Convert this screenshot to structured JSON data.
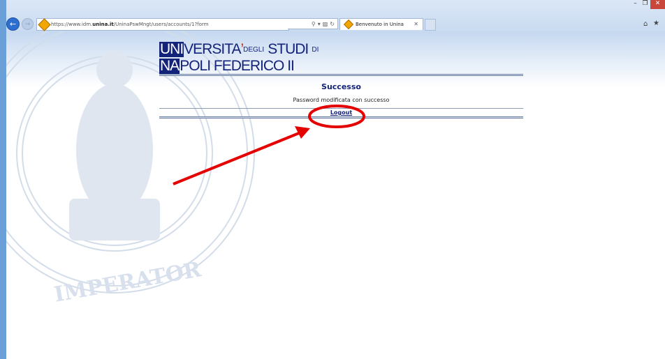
{
  "browser": {
    "url_prefix": "https://www.idm.",
    "url_domain": "unina.it",
    "url_path": "/UninaPswMngt/users/accounts/1?form",
    "tab_title": "Benvenuto in Unina",
    "back_icon": "back-arrow-icon",
    "forward_icon": "forward-arrow-icon"
  },
  "logo": {
    "uni": "UNI",
    "versita": "VERSITA",
    "apostrophe": "’",
    "degli": "DEGLI",
    "studi": "STUDI",
    "di": "DI",
    "na": "NA",
    "poli": "POLI FEDERICO II"
  },
  "content": {
    "title": "Successo",
    "message": "Password modificata con successo",
    "logout_label": "Logout"
  },
  "colors": {
    "brand": "#14237a",
    "annotation": "#e50000"
  }
}
